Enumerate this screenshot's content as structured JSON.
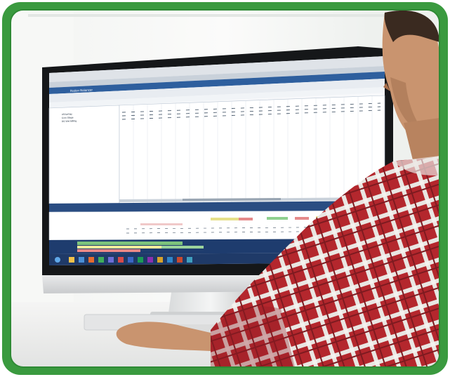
{
  "image": {
    "kind": "photograph",
    "subject": "person viewing spreadsheet software on a desktop monitor",
    "frame_color": "#3a9a3f",
    "colors": {
      "window_light": "#eef2f1",
      "monitor_bezel": "#1b1d20",
      "taskbar": "#1f3a68",
      "app_blue": "#2e5f9e",
      "shirt_red": "#b4272d",
      "shirt_white": "#e9e6e2",
      "skin": "#c9946f",
      "hair": "#3a2a20"
    }
  },
  "screen": {
    "app_title": "Ration Balancer",
    "rows": [
      [
        "Alf Aa/Hay",
        "0.000",
        "0.000",
        "0.0"
      ],
      [
        "Corn Silage",
        "0.000",
        "0.000",
        "0.0"
      ],
      [
        "DG Wet Milling",
        "0.000",
        "0.000",
        "0.0"
      ]
    ]
  }
}
